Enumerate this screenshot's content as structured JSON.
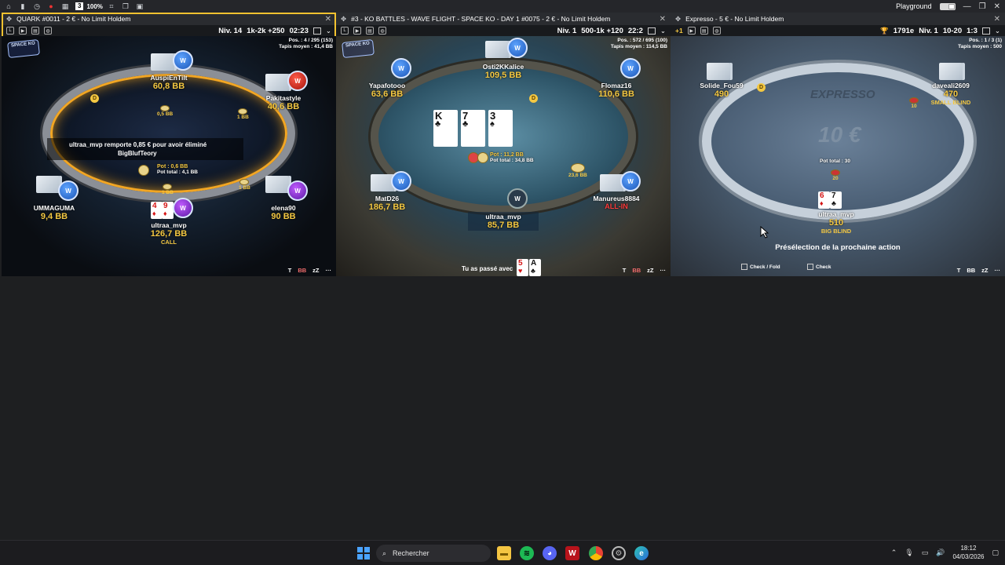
{
  "topbar": {
    "tables_count": "3",
    "zoom": "100%",
    "user": "Playground"
  },
  "tables": [
    {
      "title": "QUARK #0011 - 2 € - No Limit Holdem",
      "level": "Niv. 14",
      "blinds": "1k-2k +250",
      "timer": "02:23",
      "pos": "Pos. : 4 / 295  (153)",
      "avg": "Tapis moyen : 41,4 BB",
      "logo": "SPACE KO",
      "players": [
        {
          "name": "AuspiEnTilt",
          "stack": "60,8 BB"
        },
        {
          "name": "Pakitastyle",
          "stack": "40,6 BB"
        },
        {
          "name": "UMMAGUMA",
          "stack": "9,4 BB"
        },
        {
          "name": "elena90",
          "stack": "90 BB"
        },
        {
          "name": "ultraa_mvp",
          "stack": "126,7 BB",
          "status": "CALL"
        }
      ],
      "bets": [
        "0,5 BB",
        "1 BB",
        "1 BB",
        "1 BB"
      ],
      "pot": "Pot : 0,6 BB",
      "pot_total": "Pot total : 4,1 BB",
      "message_line1": "ultraa_mvp remporte 0,85 € pour avoir éliminé",
      "message_line2": "BigBlufTeory",
      "hero_cards": [
        {
          "rank": "4",
          "suit": "♦"
        },
        {
          "rank": "9",
          "suit": "♦"
        }
      ],
      "bottom_icons": [
        "T",
        "BB",
        "zZ",
        "···"
      ]
    },
    {
      "title": "#3 - KO BATTLES - WAVE FLIGHT - SPACE KO - DAY 1 #0075 - 2 € - No Limit Holdem",
      "level": "Niv. 1",
      "blinds": "500-1k +120",
      "timer": "22:2",
      "pos": "Pos. : 572 / 695  (100)",
      "avg": "Tapis moyen : 114,5 BB",
      "logo": "SPACE KO",
      "players": [
        {
          "name": "Osti2KKalice",
          "stack": "109,5 BB"
        },
        {
          "name": "Yapafotooo",
          "stack": "63,6 BB"
        },
        {
          "name": "Flomaz16",
          "stack": "110,6 BB"
        },
        {
          "name": "MatD26",
          "stack": "186,7 BB"
        },
        {
          "name": "Manureus8884",
          "stack": "ALL-IN"
        },
        {
          "name": "ultraa_mvp",
          "stack": "85,7 BB"
        }
      ],
      "side_bet": "23,6 BB",
      "pot": "Pot : 11,2 BB",
      "pot_total": "Pot total : 34,8 BB",
      "board": [
        {
          "rank": "K",
          "suit": "♣"
        },
        {
          "rank": "7",
          "suit": "♣"
        },
        {
          "rank": "3",
          "suit": "♠"
        }
      ],
      "passed_label": "Tu as passé avec",
      "passed_cards": [
        {
          "rank": "5",
          "suit": "♥"
        },
        {
          "rank": "A",
          "suit": "♣"
        }
      ],
      "bottom_icons": [
        "T",
        "BB",
        "zZ",
        "···"
      ]
    },
    {
      "title": "Expresso - 5 € - No Limit Holdem",
      "plus": "+1",
      "coins": "1791e",
      "level": "Niv. 1",
      "blinds": "10-20",
      "timer": "1:3",
      "pos": "Pos. : 1 / 3  (1)",
      "avg": "Tapis moyen : 500",
      "brand": "EXPRESSO",
      "prize": "10 €",
      "players": [
        {
          "name": "Solide_Fou59",
          "stack": "490"
        },
        {
          "name": "daveali2609",
          "stack": "470",
          "status": "SMALL BLIND"
        },
        {
          "name": "ultraa_mvp",
          "stack": "510",
          "status": "BIG BLIND"
        }
      ],
      "sb_bet": "10",
      "bb_bet": "20",
      "pot_total": "Pot total : 30",
      "hero_cards": [
        {
          "rank": "6",
          "suit": "♦"
        },
        {
          "rank": "7",
          "suit": "♣"
        }
      ],
      "preselect_title": "Présélection de la prochaine action",
      "preselect_options": [
        "Check / Fold",
        "Check"
      ],
      "bottom_icons": [
        "T",
        "BB",
        "zZ",
        "···"
      ]
    }
  ],
  "taskbar": {
    "search_label": "Rechercher",
    "time": "18:12",
    "date": "04/03/2026"
  }
}
